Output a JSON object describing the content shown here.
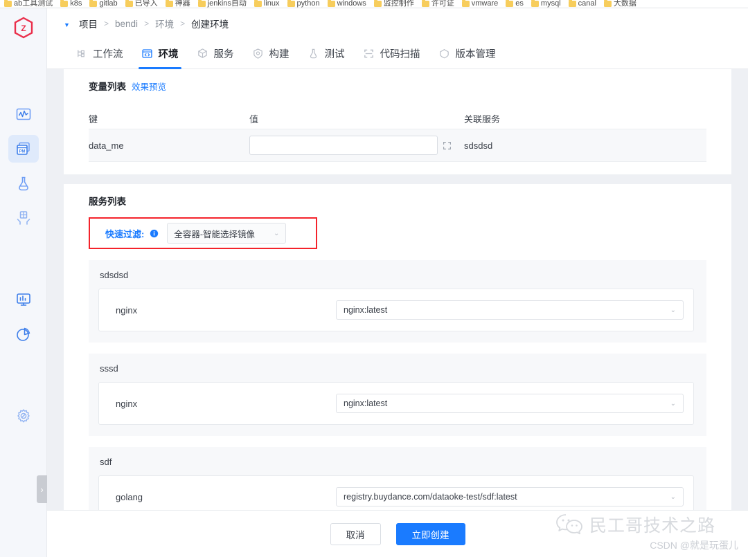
{
  "browser": {
    "bookmarks": [
      "ab工具测试",
      "k8s",
      "gitlab",
      "已导入",
      "神器",
      "jenkins自动",
      "linux",
      "python",
      "windows",
      "监控制作",
      "许可证",
      "vmware",
      "es",
      "mysql",
      "canal",
      "大数据"
    ]
  },
  "sidebar": {
    "logo_name": "z-logo",
    "items": [
      {
        "name": "monitoring",
        "icon": "wave-chart-icon",
        "active": false
      },
      {
        "name": "pm",
        "icon": "pm-windows-icon",
        "active": true
      },
      {
        "name": "lab",
        "icon": "flask-icon",
        "active": false
      },
      {
        "name": "delivery",
        "icon": "package-hands-icon",
        "active": false
      },
      {
        "name": "dashboard",
        "icon": "monitor-bars-icon",
        "active": false
      },
      {
        "name": "analytics",
        "icon": "pie-chart-icon",
        "active": false
      },
      {
        "name": "settings",
        "icon": "gear-icon",
        "active": false
      }
    ],
    "collapse_handle": "›"
  },
  "breadcrumb": {
    "caret": "▼",
    "items": [
      "项目",
      "bendi",
      "环境",
      "创建环境"
    ],
    "separator": ">"
  },
  "tabs": [
    {
      "label": "工作流",
      "icon": "workflow-icon",
      "active": false
    },
    {
      "label": "环境",
      "icon": "code-window-icon",
      "active": true
    },
    {
      "label": "服务",
      "icon": "cube-icon",
      "active": false
    },
    {
      "label": "构建",
      "icon": "build-shield-icon",
      "active": false
    },
    {
      "label": "测试",
      "icon": "flask-icon",
      "active": false
    },
    {
      "label": "代码扫描",
      "icon": "scan-icon",
      "active": false
    },
    {
      "label": "版本管理",
      "icon": "version-tag-icon",
      "active": false
    }
  ],
  "variables": {
    "title": "变量列表",
    "preview_link": "效果预览",
    "columns": [
      "键",
      "值",
      "关联服务"
    ],
    "rows": [
      {
        "key": "data_me",
        "value": "",
        "value_placeholder": "",
        "service": "sdsdsd"
      }
    ]
  },
  "services": {
    "title": "服务列表",
    "filter_label": "快速过滤:",
    "filter_value": "全容器-智能选择镜像",
    "chevron": "⌄",
    "blocks": [
      {
        "name": "sdsdsd",
        "containers": [
          {
            "name": "nginx",
            "image": "nginx:latest"
          }
        ]
      },
      {
        "name": "sssd",
        "containers": [
          {
            "name": "nginx",
            "image": "nginx:latest"
          }
        ]
      },
      {
        "name": "sdf",
        "containers": [
          {
            "name": "golang",
            "image": "registry.buydance.com/dataoke-test/sdf:latest"
          }
        ]
      }
    ]
  },
  "footer": {
    "cancel_label": "取消",
    "submit_label": "立即创建"
  },
  "watermark": {
    "title": "民工哥技术之路",
    "subtitle": "CSDN @就是玩蛋儿",
    "icon": "wechat-icon"
  },
  "colors": {
    "accent": "#1a7bff",
    "highlight": "#f4232b",
    "logo": "#ea2f4b"
  }
}
